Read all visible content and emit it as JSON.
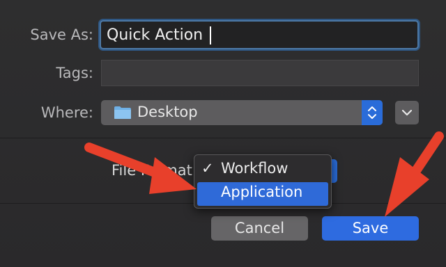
{
  "form": {
    "save_as_label": "Save As:",
    "save_as_value": "Quick Action",
    "tags_label": "Tags:",
    "where_label": "Where:",
    "where_value": "Desktop",
    "file_format_label": "File Format:"
  },
  "menu": {
    "items": [
      {
        "label": "Workflow",
        "checked": true,
        "check_mark": "✓"
      },
      {
        "label": "Application",
        "highlighted": true
      }
    ]
  },
  "buttons": {
    "cancel": "Cancel",
    "save": "Save"
  },
  "colors": {
    "accent": "#2e6be0",
    "arrow": "#e8402b",
    "background": "#2c2b2c"
  },
  "icons": {
    "folder": "folder-icon",
    "stepper": "up-down-chevron-icon",
    "disclosure": "chevron-down-icon",
    "annotation": "red-arrow-icon"
  }
}
